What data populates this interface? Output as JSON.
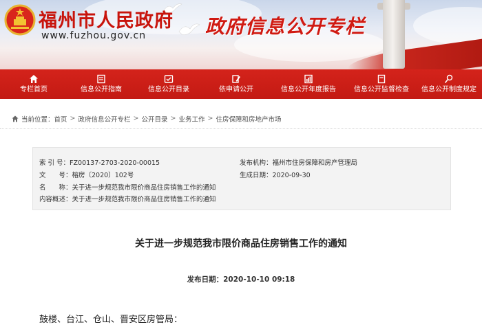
{
  "header": {
    "site_title": "福州市人民政府",
    "site_url": "www.fuzhou.gov.cn",
    "column_title": "政府信息公开专栏"
  },
  "nav": {
    "items": [
      {
        "label": "专栏首页",
        "icon": "home-icon"
      },
      {
        "label": "信息公开指南",
        "icon": "guide-book-icon"
      },
      {
        "label": "信息公开目录",
        "icon": "catalog-icon"
      },
      {
        "label": "依申请公开",
        "icon": "apply-edit-icon"
      },
      {
        "label": "信息公开年度报告",
        "icon": "report-icon"
      },
      {
        "label": "信息公开监督检查",
        "icon": "inspection-icon"
      },
      {
        "label": "信息公开制度规定",
        "icon": "regulation-icon"
      }
    ],
    "colors": {
      "bar": "#c81d15",
      "text": "#ffffff"
    }
  },
  "breadcrumb": {
    "prefix": "当前位置：",
    "items": [
      "首页",
      "政府信息公开专栏",
      "公开目录",
      "业务工作",
      "住房保障和房地产市场"
    ],
    "separator": ">"
  },
  "info": {
    "index_label": "索 引 号：",
    "index_value": "FZ00137-2703-2020-00015",
    "doc_no_label": "文　　号：",
    "doc_no_value": "榕房〔2020〕102号",
    "name_label": "名　　称：",
    "name_value": "关于进一步规范我市限价商品住房销售工作的通知",
    "summary_label": "内容概述：",
    "summary_value": "关于进一步规范我市限价商品住房销售工作的通知",
    "issuer_label": "发布机构：",
    "issuer_value": "福州市住房保障和房产管理局",
    "created_label": "生成日期：",
    "created_value": "2020-09-30"
  },
  "article": {
    "title": "关于进一步规范我市限价商品住房销售工作的通知",
    "pub_label": "发布日期：",
    "pub_value": "2020-10-10 09:18",
    "salutation": "鼓楼、台江、仓山、晋安区房管局："
  }
}
